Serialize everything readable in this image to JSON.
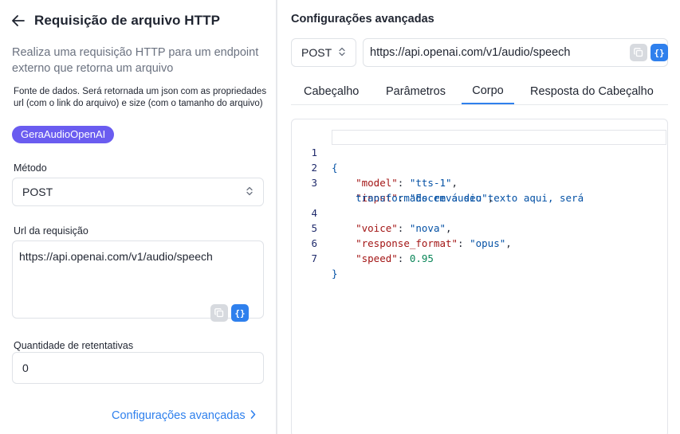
{
  "left": {
    "title": "Requisição de arquivo HTTP",
    "description": "Realiza uma requisição HTTP para um endpoint externo que retorna um arquivo",
    "fonte_text": "Fonte de dados. Será retornada um json com as propriedades url (com o link do arquivo) e size (com o tamanho do arquivo)",
    "chip_label": "GeraAudioOpenAI",
    "method_label": "Método",
    "method_value": "POST",
    "url_label": "Url da requisição",
    "url_value": "https://api.openai.com/v1/audio/speech",
    "retries_label": "Quantidade de retentativas",
    "retries_value": "0",
    "advanced_link": "Configurações avançadas"
  },
  "right": {
    "title": "Configurações avançadas",
    "method_value": "POST",
    "url_value": "https://api.openai.com/v1/audio/speech",
    "tabs": [
      "Cabeçalho",
      "Parâmetros",
      "Corpo",
      "Resposta do Cabeçalho"
    ],
    "active_tab": "Corpo",
    "json_btn": "{}"
  },
  "code": {
    "line_numbers": [
      "1",
      "2",
      "3",
      "",
      "4",
      "5",
      "6",
      "7"
    ],
    "open_brace": "{",
    "close_brace": "}",
    "model_key": "\"model\"",
    "model_val": "\"tts-1\"",
    "input_key": "\"input\"",
    "input_val_1": "\"Escreva seu texto aqui, será",
    "input_val_2": "transformado em áudio\"",
    "voice_key": "\"voice\"",
    "voice_val": "\"nova\"",
    "format_key": "\"response_format\"",
    "format_val": "\"opus\"",
    "speed_key": "\"speed\"",
    "speed_val": "0.95"
  },
  "colors": {
    "accent": "#2f80ed",
    "chip": "#6a5cf0"
  },
  "icons": [
    "arrow-left-icon",
    "chevron-updown-icon",
    "copy-icon",
    "braces-icon",
    "chevron-right-icon"
  ]
}
